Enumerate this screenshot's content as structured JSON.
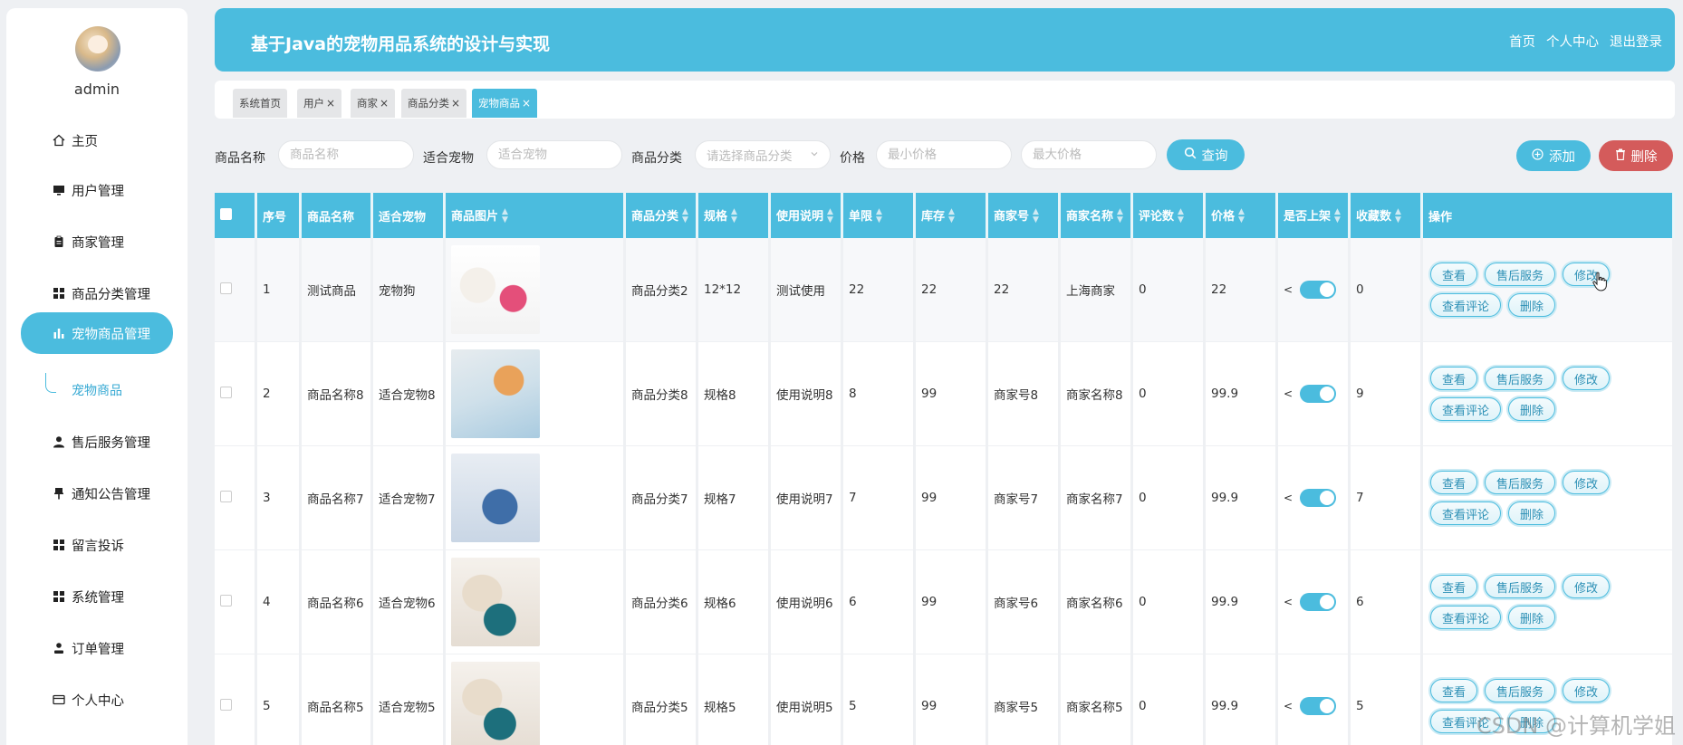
{
  "sidebar": {
    "username": "admin",
    "items": [
      {
        "label": "主页",
        "icon": "home-icon"
      },
      {
        "label": "用户管理",
        "icon": "monitor-icon"
      },
      {
        "label": "商家管理",
        "icon": "clipboard-icon"
      },
      {
        "label": "商品分类管理",
        "icon": "grid-icon"
      },
      {
        "label": "宠物商品管理",
        "icon": "bar-chart-icon"
      },
      {
        "label": "售后服务管理",
        "icon": "user-icon"
      },
      {
        "label": "通知公告管理",
        "icon": "pin-icon"
      },
      {
        "label": "留言投诉",
        "icon": "grid-icon"
      },
      {
        "label": "系统管理",
        "icon": "grid-icon"
      },
      {
        "label": "订单管理",
        "icon": "person-icon"
      },
      {
        "label": "个人中心",
        "icon": "card-icon"
      }
    ],
    "subitem": "宠物商品"
  },
  "header": {
    "title": "基于Java的宠物用品系统的设计与实现",
    "links": [
      "首页",
      "个人中心",
      "退出登录"
    ]
  },
  "tabs": [
    "系统首页",
    "用户",
    "商家",
    "商品分类",
    "宠物商品"
  ],
  "search": {
    "name_label": "商品名称",
    "name_placeholder": "商品名称",
    "pet_label": "适合宠物",
    "pet_placeholder": "适合宠物",
    "cat_label": "商品分类",
    "cat_placeholder": "请选择商品分类",
    "price_label": "价格",
    "min_placeholder": "最小价格",
    "max_placeholder": "最大价格",
    "query_label": "查询",
    "add_label": "添加",
    "delete_label": "删除"
  },
  "table": {
    "headers": [
      "序号",
      "商品名称",
      "适合宠物",
      "商品图片",
      "商品分类",
      "规格",
      "使用说明",
      "单限",
      "库存",
      "商家号",
      "商家名称",
      "评论数",
      "价格",
      "是否上架",
      "收藏数",
      "操作"
    ],
    "ops": [
      "查看",
      "售后服务",
      "修改",
      "查看评论",
      "删除"
    ],
    "rows": [
      [
        "1",
        "测试商品",
        "宠物狗",
        "商品分类2",
        "12*12",
        "测试使用",
        "22",
        "22",
        "22",
        "上海商家",
        "0",
        "22",
        "0"
      ],
      [
        "2",
        "商品名称8",
        "适合宠物8",
        "商品分类8",
        "规格8",
        "使用说明8",
        "8",
        "99",
        "商家号8",
        "商家名称8",
        "0",
        "99.9",
        "9"
      ],
      [
        "3",
        "商品名称7",
        "适合宠物7",
        "商品分类7",
        "规格7",
        "使用说明7",
        "7",
        "99",
        "商家号7",
        "商家名称7",
        "0",
        "99.9",
        "7"
      ],
      [
        "4",
        "商品名称6",
        "适合宠物6",
        "商品分类6",
        "规格6",
        "使用说明6",
        "6",
        "99",
        "商家号6",
        "商家名称6",
        "0",
        "99.9",
        "6"
      ],
      [
        "5",
        "商品名称5",
        "适合宠物5",
        "商品分类5",
        "规格5",
        "使用说明5",
        "5",
        "99",
        "商家号5",
        "商家名称5",
        "0",
        "99.9",
        "5"
      ]
    ]
  },
  "watermark": "CSDN @计算机学姐",
  "colors": {
    "accent": "#4bbcde",
    "danger": "#d45b5b"
  }
}
